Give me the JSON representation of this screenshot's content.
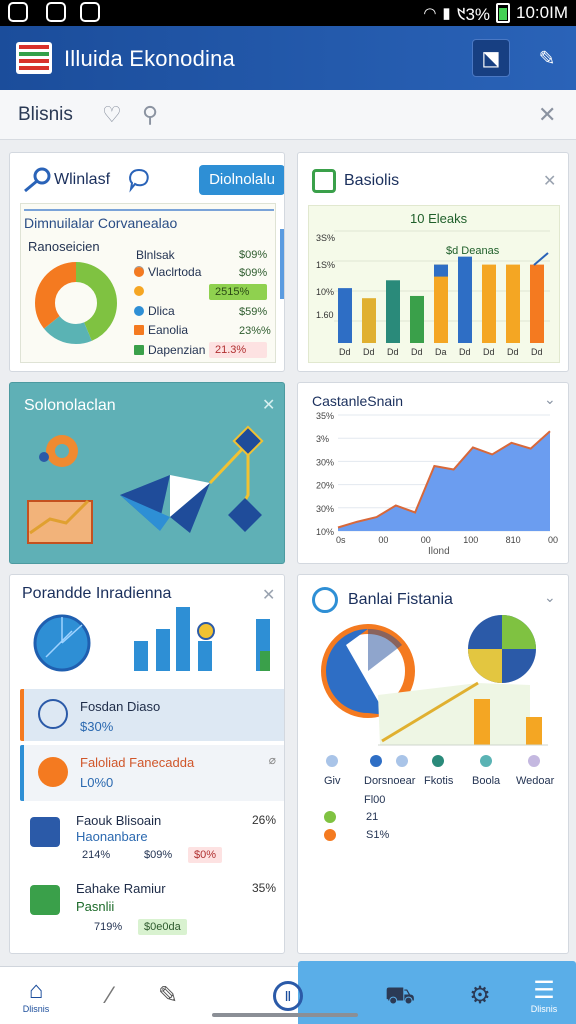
{
  "status": {
    "battery_pct": "᱑3%",
    "time": "10:0IM"
  },
  "app": {
    "title": "Illuida Ekonodina"
  },
  "search": {
    "label": "Blisnis"
  },
  "card1": {
    "title": "Wlinlasf",
    "button": "Diolnolalu",
    "subtitle": "Dimnuilalar  Corvanealao",
    "section": "Ranoseicien",
    "rows": [
      {
        "label": "Blnlsak",
        "value": "$09%"
      },
      {
        "label": "Vlaclrtoda",
        "value": "$09%"
      },
      {
        "label": "",
        "value": "2515%"
      },
      {
        "label": "Dlica",
        "value": "$59%"
      },
      {
        "label": "Eanolia",
        "value": "23%%"
      },
      {
        "label": "Dapenzian",
        "value": "21.3%"
      }
    ]
  },
  "card2": {
    "title": "Basiolis",
    "chart_title": "10 Eleaks",
    "legend": "$d  Deanas",
    "y_ticks": [
      "3S%",
      "1S%",
      "10%",
      "1.60"
    ],
    "x_ticks": [
      "Dd",
      "Dd",
      "Dd",
      "Dd",
      "Da",
      "Dd",
      "Dd",
      "Dd",
      "Dd"
    ]
  },
  "card3": {
    "title": "Solonolaclan"
  },
  "card4": {
    "title": "CastanleSnain",
    "y_ticks": [
      "35%",
      "3%",
      "30%",
      "20%",
      "30%",
      "10%"
    ],
    "x_ticks": [
      "0s",
      "00",
      "00",
      "100",
      "810",
      "00"
    ],
    "x_label": "Ilond"
  },
  "card5": {
    "title": "Porandde  Inradienna",
    "items": [
      {
        "title": "Fosdan Diaso",
        "sub": "$30%",
        "pct": ""
      },
      {
        "title": "Faloliad Fanecadda",
        "sub": "L0%0",
        "pct": ""
      },
      {
        "title": "Faouk Blisoain",
        "sub": "Haonanbare",
        "pct": "26%",
        "tags": [
          "214%",
          "$09%",
          "$0%"
        ]
      },
      {
        "title": "Eahake Ramiur",
        "sub": "Pasnlii",
        "pct": "35%",
        "tags": [
          "719%",
          "$0e0da"
        ]
      }
    ]
  },
  "card6": {
    "title": "Banlai Fistania",
    "legend": [
      "Giv",
      "Dorsnoear",
      "Fkotis",
      "Boola",
      "Wedoar"
    ],
    "footer_title": "Fl00",
    "footer_rows": [
      "21",
      "S1%"
    ]
  },
  "nav": {
    "home": "Dlisnis",
    "menu": "Dlisnis"
  },
  "colors": {
    "primary": "#1b4d9b",
    "accent": "#2e8fd5",
    "orange": "#f47a20",
    "green": "#7fc241",
    "teal": "#5ab3b4"
  },
  "chart_data": [
    {
      "type": "bar",
      "title": "10 Eleaks",
      "categories": [
        "Dd",
        "Dd",
        "Dd",
        "Dd",
        "Da",
        "Dd",
        "Dd",
        "Dd",
        "Dd"
      ],
      "y_ticks": [
        "3S%",
        "1S%",
        "10%",
        "1.60"
      ],
      "series": [
        {
          "values": [
            49,
            40,
            56,
            42,
            70,
            77,
            70,
            70,
            70
          ]
        }
      ],
      "ylim": [
        0,
        100
      ],
      "grid": true
    },
    {
      "type": "area",
      "title": "CastanleSnain",
      "x": [
        "0s",
        "00",
        "00",
        "100",
        "810",
        "00"
      ],
      "y_ticks": [
        "35%",
        "3%",
        "30%",
        "20%",
        "30%",
        "10%"
      ],
      "values": [
        3,
        8,
        12,
        22,
        16,
        56,
        53,
        72,
        66,
        76,
        71,
        86
      ],
      "xlabel": "Ilond",
      "ylim": [
        0,
        100
      ],
      "grid": true
    }
  ]
}
